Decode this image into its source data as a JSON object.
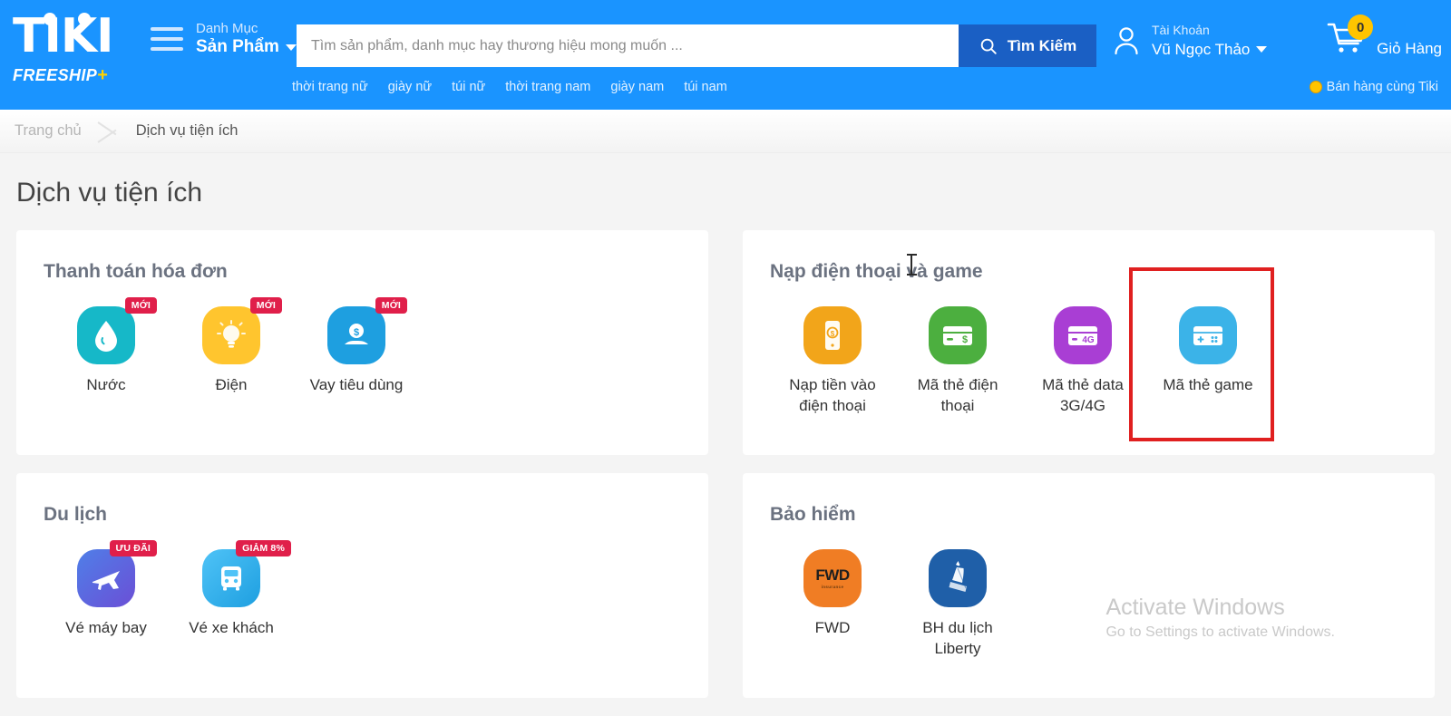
{
  "colors": {
    "header_blue": "#1a94ff",
    "search_button_blue": "#1a5fc4",
    "badge_red": "#e01f4a",
    "annotation_red": "#e02020",
    "cart_badge_yellow": "#ffc400",
    "page_bg": "#f4f4f4"
  },
  "header": {
    "logo_text": "TIKI",
    "logo_tagline": "FREESHIP",
    "logo_tagline_plus": "+",
    "category_menu": {
      "icon": "hamburger-icon",
      "line1": "Danh Mục",
      "line2": "Sản Phẩm",
      "caret": "chevron-down-icon"
    },
    "search": {
      "placeholder": "Tìm sản phẩm, danh mục hay thương hiệu mong muốn ...",
      "value": "",
      "button_label": "Tìm Kiếm",
      "button_icon": "search-icon"
    },
    "account": {
      "icon": "user-icon",
      "line1": "Tài Khoản",
      "line2": "Vũ Ngọc Thảo",
      "caret": "chevron-down-icon"
    },
    "cart": {
      "icon": "cart-icon",
      "count": "0",
      "label": "Giỏ Hàng"
    },
    "nav_links": [
      "thời trang nữ",
      "giày nữ",
      "túi nữ",
      "thời trang nam",
      "giày nam",
      "túi nam"
    ],
    "seller_link": {
      "icon": "coin-icon",
      "label": "Bán hàng cùng Tiki"
    }
  },
  "breadcrumb": {
    "home": "Trang chủ",
    "separator": "chevron-right-icon",
    "current": "Dịch vụ tiện ích"
  },
  "page_title": "Dịch vụ tiện ích",
  "cards": [
    {
      "id": "thanh-toan-hoa-don",
      "title": "Thanh toán hóa đơn",
      "services": [
        {
          "label": "Nước",
          "icon": "water-drop-icon",
          "badge": "MỚI",
          "bg": "#16b8c8"
        },
        {
          "label": "Điện",
          "icon": "lightbulb-icon",
          "badge": "MỚI",
          "bg": "#ffc52e"
        },
        {
          "label": "Vay tiêu dùng",
          "icon": "hand-money-icon",
          "badge": "MỚI",
          "bg": "#1e9fe0"
        }
      ]
    },
    {
      "id": "nap-dien-thoai-va-game",
      "title": "Nạp điện thoại và game",
      "services": [
        {
          "label": "Nạp tiền vào điện thoại",
          "icon": "phone-topup-icon",
          "badge": "",
          "bg": "#f2a51a"
        },
        {
          "label": "Mã thẻ điện thoại",
          "icon": "card-dollar-icon",
          "badge": "",
          "bg": "#4caf3f"
        },
        {
          "label": "Mã thẻ data 3G/4G",
          "icon": "card-4g-icon",
          "badge": "",
          "bg": "#a93ed4"
        },
        {
          "label": "Mã thẻ game",
          "icon": "gamepad-card-icon",
          "badge": "",
          "bg": "#3bb3e8",
          "highlighted": true
        }
      ]
    },
    {
      "id": "du-lich",
      "title": "Du lịch",
      "services": [
        {
          "label": "Vé máy bay",
          "icon": "airplane-icon",
          "badge": "ƯU ĐÃI",
          "bg": "#5b5fd6"
        },
        {
          "label": "Vé xe khách",
          "icon": "bus-icon",
          "badge": "GIẢM 8%",
          "bg": "#36b6ef"
        }
      ]
    },
    {
      "id": "bao-hiem",
      "title": "Bảo hiểm",
      "services": [
        {
          "label": "FWD",
          "icon": "fwd-logo-icon",
          "badge": "",
          "bg": "#f07d24",
          "logo_text": "FWD",
          "logo_sub": "insurance"
        },
        {
          "label": "BH du lịch Liberty",
          "icon": "liberty-statue-icon",
          "badge": "",
          "bg": "#1f5fa8"
        }
      ]
    }
  ],
  "annotation": {
    "label": "highlight-box-ma-the-game"
  },
  "watermark": {
    "title": "Activate Windows",
    "subtitle": "Go to Settings to activate Windows."
  }
}
